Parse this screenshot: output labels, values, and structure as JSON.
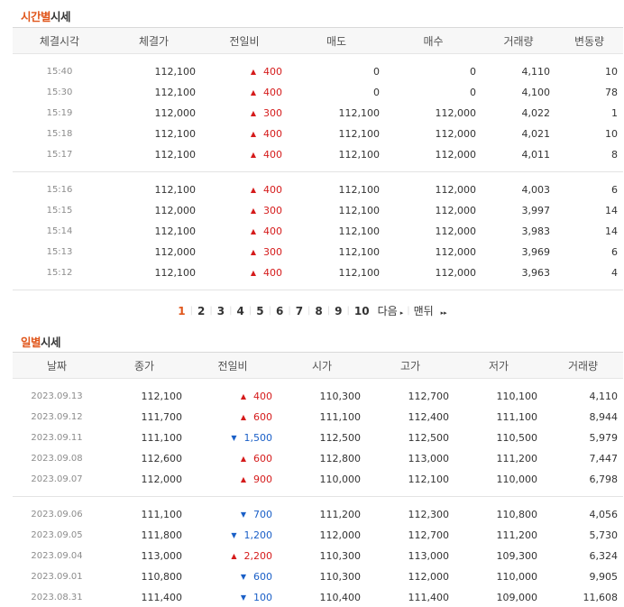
{
  "time_section": {
    "title_accent": "시간별",
    "title_rest": "시세",
    "headers": [
      "체결시각",
      "체결가",
      "전일비",
      "매도",
      "매수",
      "거래량",
      "변동량"
    ],
    "rows": [
      {
        "time": "15:40",
        "price": "112,100",
        "dir": "up",
        "arrow": "▲",
        "change": "400",
        "ask": "0",
        "bid": "0",
        "volume": "4,110",
        "delta": "10"
      },
      {
        "time": "15:30",
        "price": "112,100",
        "dir": "up",
        "arrow": "▲",
        "change": "400",
        "ask": "0",
        "bid": "0",
        "volume": "4,100",
        "delta": "78"
      },
      {
        "time": "15:19",
        "price": "112,000",
        "dir": "up",
        "arrow": "▲",
        "change": "300",
        "ask": "112,100",
        "bid": "112,000",
        "volume": "4,022",
        "delta": "1"
      },
      {
        "time": "15:18",
        "price": "112,100",
        "dir": "up",
        "arrow": "▲",
        "change": "400",
        "ask": "112,100",
        "bid": "112,000",
        "volume": "4,021",
        "delta": "10"
      },
      {
        "time": "15:17",
        "price": "112,100",
        "dir": "up",
        "arrow": "▲",
        "change": "400",
        "ask": "112,100",
        "bid": "112,000",
        "volume": "4,011",
        "delta": "8"
      },
      {
        "time": "15:16",
        "price": "112,100",
        "dir": "up",
        "arrow": "▲",
        "change": "400",
        "ask": "112,100",
        "bid": "112,000",
        "volume": "4,003",
        "delta": "6"
      },
      {
        "time": "15:15",
        "price": "112,000",
        "dir": "up",
        "arrow": "▲",
        "change": "300",
        "ask": "112,100",
        "bid": "112,000",
        "volume": "3,997",
        "delta": "14"
      },
      {
        "time": "15:14",
        "price": "112,100",
        "dir": "up",
        "arrow": "▲",
        "change": "400",
        "ask": "112,100",
        "bid": "112,000",
        "volume": "3,983",
        "delta": "14"
      },
      {
        "time": "15:13",
        "price": "112,000",
        "dir": "up",
        "arrow": "▲",
        "change": "300",
        "ask": "112,100",
        "bid": "112,000",
        "volume": "3,969",
        "delta": "6"
      },
      {
        "time": "15:12",
        "price": "112,100",
        "dir": "up",
        "arrow": "▲",
        "change": "400",
        "ask": "112,100",
        "bid": "112,000",
        "volume": "3,963",
        "delta": "4"
      }
    ]
  },
  "pager": {
    "pages": [
      "1",
      "2",
      "3",
      "4",
      "5",
      "6",
      "7",
      "8",
      "9",
      "10"
    ],
    "current": "1",
    "next_label": "다음",
    "next_icon": "▸",
    "last_label": "맨뒤",
    "last_icon": "▸▸"
  },
  "daily_section": {
    "title_accent": "일별",
    "title_rest": "시세",
    "headers": [
      "날짜",
      "종가",
      "전일비",
      "시가",
      "고가",
      "저가",
      "거래량"
    ],
    "rows": [
      {
        "date": "2023.09.13",
        "close": "112,100",
        "dir": "up",
        "arrow": "▲",
        "change": "400",
        "open": "110,300",
        "high": "112,700",
        "low": "110,100",
        "volume": "4,110"
      },
      {
        "date": "2023.09.12",
        "close": "111,700",
        "dir": "up",
        "arrow": "▲",
        "change": "600",
        "open": "111,100",
        "high": "112,400",
        "low": "111,100",
        "volume": "8,944"
      },
      {
        "date": "2023.09.11",
        "close": "111,100",
        "dir": "down",
        "arrow": "▼",
        "change": "1,500",
        "open": "112,500",
        "high": "112,500",
        "low": "110,500",
        "volume": "5,979"
      },
      {
        "date": "2023.09.08",
        "close": "112,600",
        "dir": "up",
        "arrow": "▲",
        "change": "600",
        "open": "112,800",
        "high": "113,000",
        "low": "111,200",
        "volume": "7,447"
      },
      {
        "date": "2023.09.07",
        "close": "112,000",
        "dir": "up",
        "arrow": "▲",
        "change": "900",
        "open": "110,000",
        "high": "112,100",
        "low": "110,000",
        "volume": "6,798"
      },
      {
        "date": "2023.09.06",
        "close": "111,100",
        "dir": "down",
        "arrow": "▼",
        "change": "700",
        "open": "111,200",
        "high": "112,300",
        "low": "110,800",
        "volume": "4,056"
      },
      {
        "date": "2023.09.05",
        "close": "111,800",
        "dir": "down",
        "arrow": "▼",
        "change": "1,200",
        "open": "112,000",
        "high": "112,700",
        "low": "111,200",
        "volume": "5,730"
      },
      {
        "date": "2023.09.04",
        "close": "113,000",
        "dir": "up",
        "arrow": "▲",
        "change": "2,200",
        "open": "110,300",
        "high": "113,000",
        "low": "109,300",
        "volume": "6,324"
      },
      {
        "date": "2023.09.01",
        "close": "110,800",
        "dir": "down",
        "arrow": "▼",
        "change": "600",
        "open": "110,300",
        "high": "112,000",
        "low": "110,000",
        "volume": "9,905"
      },
      {
        "date": "2023.08.31",
        "close": "111,400",
        "dir": "down",
        "arrow": "▼",
        "change": "100",
        "open": "110,400",
        "high": "111,400",
        "low": "109,000",
        "volume": "11,608"
      }
    ]
  }
}
